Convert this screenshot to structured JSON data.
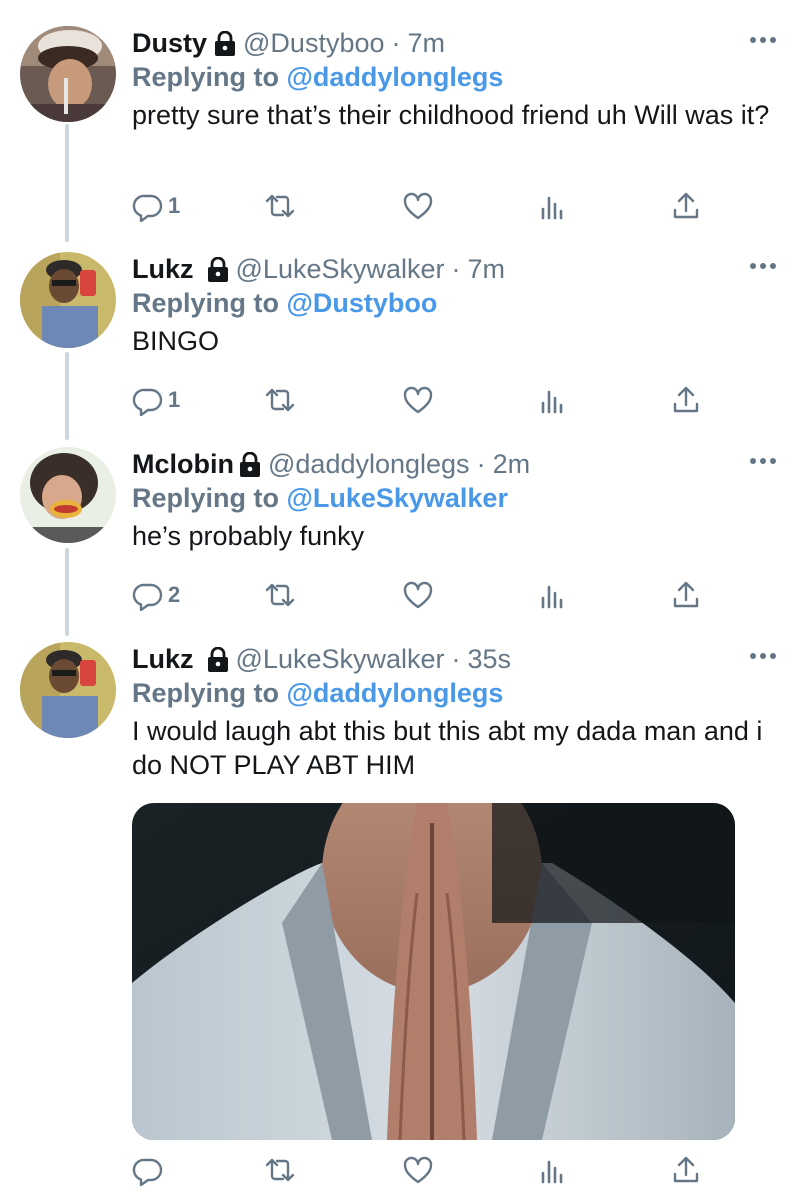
{
  "tweets": [
    {
      "name": "Dusty",
      "handle": "@Dustyboo",
      "time": "7m",
      "replying_prefix": "Replying to",
      "replying_to": "@daddylonglegs",
      "text": "pretty sure that’s their childhood friend uh Will was it?",
      "reply_count": "1"
    },
    {
      "name": "Lukz",
      "handle": "@LukeSkywalker",
      "time": "7m",
      "replying_prefix": "Replying to",
      "replying_to": "@Dustyboo",
      "text": "BINGO",
      "reply_count": "1"
    },
    {
      "name": "Mclobin",
      "handle": "@daddylonglegs",
      "time": "2m",
      "replying_prefix": "Replying to",
      "replying_to": "@LukeSkywalker",
      "text": "he’s probably funky",
      "reply_count": "2"
    },
    {
      "name": "Lukz",
      "handle": "@LukeSkywalker",
      "time": "35s",
      "replying_prefix": "Replying to",
      "replying_to": "@daddylonglegs",
      "text": "I would laugh abt this but this abt my dada man and i do NOT PLAY ABT HIM",
      "reply_count": ""
    }
  ],
  "separator": "·",
  "colors": {
    "mention": "#4a99e9",
    "muted": "#657786",
    "thread_line": "#ccd6dd"
  },
  "icons": [
    "lock-icon",
    "more-icon",
    "reply-icon",
    "retweet-icon",
    "like-icon",
    "analytics-icon",
    "share-icon"
  ]
}
